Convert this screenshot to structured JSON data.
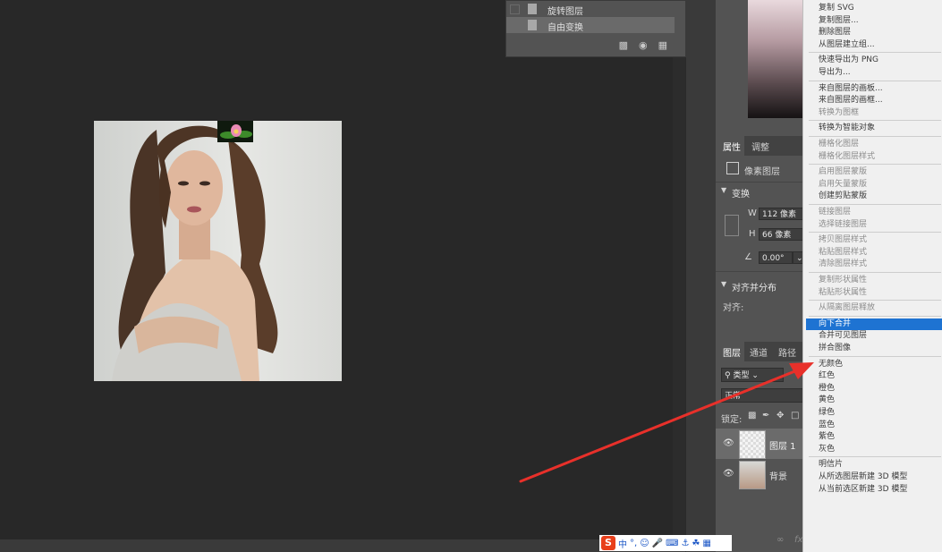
{
  "history": {
    "items": [
      "旋转图层",
      "自由变换"
    ]
  },
  "properties": {
    "tabs": [
      "属性",
      "调整"
    ],
    "layer_type": "像素图层",
    "transform_title": "变换",
    "w_label": "W",
    "w_value": "112 像素",
    "h_label": "H",
    "h_value": "66 像素",
    "angle_value": "0.00°",
    "align_title": "对齐并分布",
    "align_label": "对齐:"
  },
  "layers": {
    "tabs": [
      "图层",
      "通道",
      "路径"
    ],
    "filter_kind": "类型",
    "blend_mode": "正常",
    "lock_label": "锁定:",
    "rows": [
      {
        "name": "图层 1"
      },
      {
        "name": "背景"
      }
    ]
  },
  "context_menu": {
    "items": [
      {
        "label": "复制 SVG",
        "enabled": true
      },
      {
        "label": "复制图层...",
        "enabled": true
      },
      {
        "label": "删除图层",
        "enabled": true
      },
      {
        "label": "从图层建立组...",
        "enabled": true
      },
      {
        "sep": true
      },
      {
        "label": "快速导出为 PNG",
        "enabled": true
      },
      {
        "label": "导出为...",
        "enabled": true
      },
      {
        "sep": true
      },
      {
        "label": "来自图层的画板...",
        "enabled": true
      },
      {
        "label": "来自图层的画框...",
        "enabled": true
      },
      {
        "label": "转换为图框",
        "enabled": false
      },
      {
        "sep": true
      },
      {
        "label": "转换为智能对象",
        "enabled": true
      },
      {
        "sep": true
      },
      {
        "label": "栅格化图层",
        "enabled": false
      },
      {
        "label": "栅格化图层样式",
        "enabled": false
      },
      {
        "sep": true
      },
      {
        "label": "启用图层蒙版",
        "enabled": false
      },
      {
        "label": "启用矢量蒙版",
        "enabled": false
      },
      {
        "label": "创建剪贴蒙版",
        "enabled": true
      },
      {
        "sep": true
      },
      {
        "label": "链接图层",
        "enabled": false
      },
      {
        "label": "选择链接图层",
        "enabled": false
      },
      {
        "sep": true
      },
      {
        "label": "拷贝图层样式",
        "enabled": false
      },
      {
        "label": "粘贴图层样式",
        "enabled": false
      },
      {
        "label": "清除图层样式",
        "enabled": false
      },
      {
        "sep": true
      },
      {
        "label": "复制形状属性",
        "enabled": false
      },
      {
        "label": "粘贴形状属性",
        "enabled": false
      },
      {
        "sep": true
      },
      {
        "label": "从隔离图层释放",
        "enabled": false
      },
      {
        "sep": true
      },
      {
        "label": "向下合并",
        "enabled": true,
        "selected": true
      },
      {
        "label": "合并可见图层",
        "enabled": true
      },
      {
        "label": "拼合图像",
        "enabled": true
      },
      {
        "sep": true
      },
      {
        "label": "无颜色",
        "enabled": true
      },
      {
        "label": "红色",
        "enabled": true
      },
      {
        "label": "橙色",
        "enabled": true
      },
      {
        "label": "黄色",
        "enabled": true
      },
      {
        "label": "绿色",
        "enabled": true
      },
      {
        "label": "蓝色",
        "enabled": true
      },
      {
        "label": "紫色",
        "enabled": true
      },
      {
        "label": "灰色",
        "enabled": true
      },
      {
        "sep": true
      },
      {
        "label": "明信片",
        "enabled": true
      },
      {
        "label": "从所选图层新建 3D 模型",
        "enabled": true
      },
      {
        "label": "从当前选区新建 3D 模型",
        "enabled": true
      }
    ]
  },
  "ime_toolbar": {
    "logo": "S",
    "mode": "中",
    "punct": "°,"
  },
  "colors": {
    "menu_highlight": "#1e73d2",
    "annotation_arrow": "#e8302a"
  }
}
